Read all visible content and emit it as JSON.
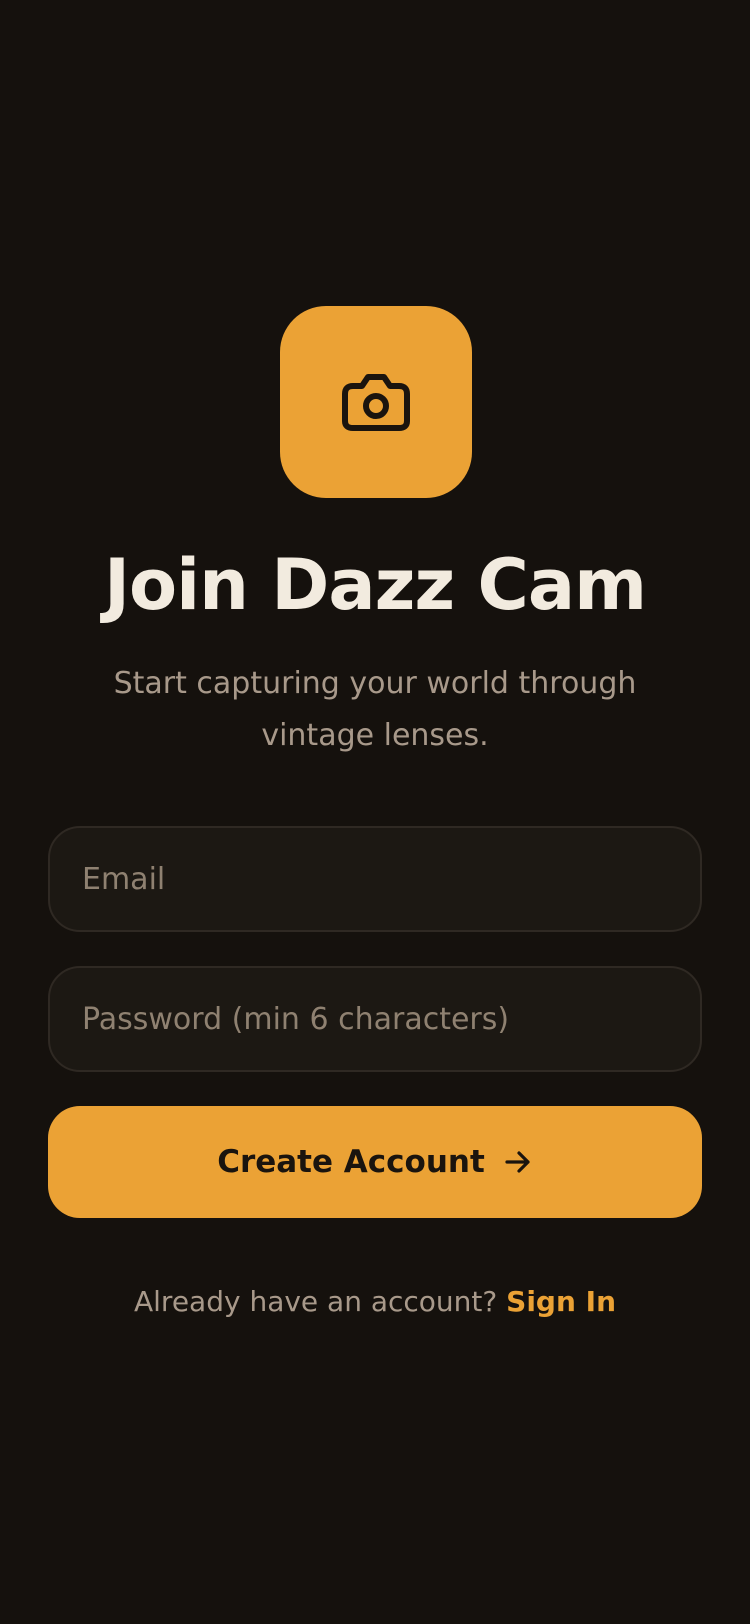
{
  "app": {
    "logo_icon": "camera-icon",
    "accent_color": "#EBA235",
    "background_color": "#15110D"
  },
  "header": {
    "title": "Join Dazz Cam",
    "subtitle": "Start capturing your world through vintage lenses."
  },
  "form": {
    "email": {
      "value": "",
      "placeholder": "Email"
    },
    "password": {
      "value": "",
      "placeholder": "Password (min 6 characters)"
    },
    "submit_label": "Create Account",
    "submit_icon": "arrow-right-icon"
  },
  "footer": {
    "prompt": "Already have an account?",
    "link_label": "Sign In"
  }
}
